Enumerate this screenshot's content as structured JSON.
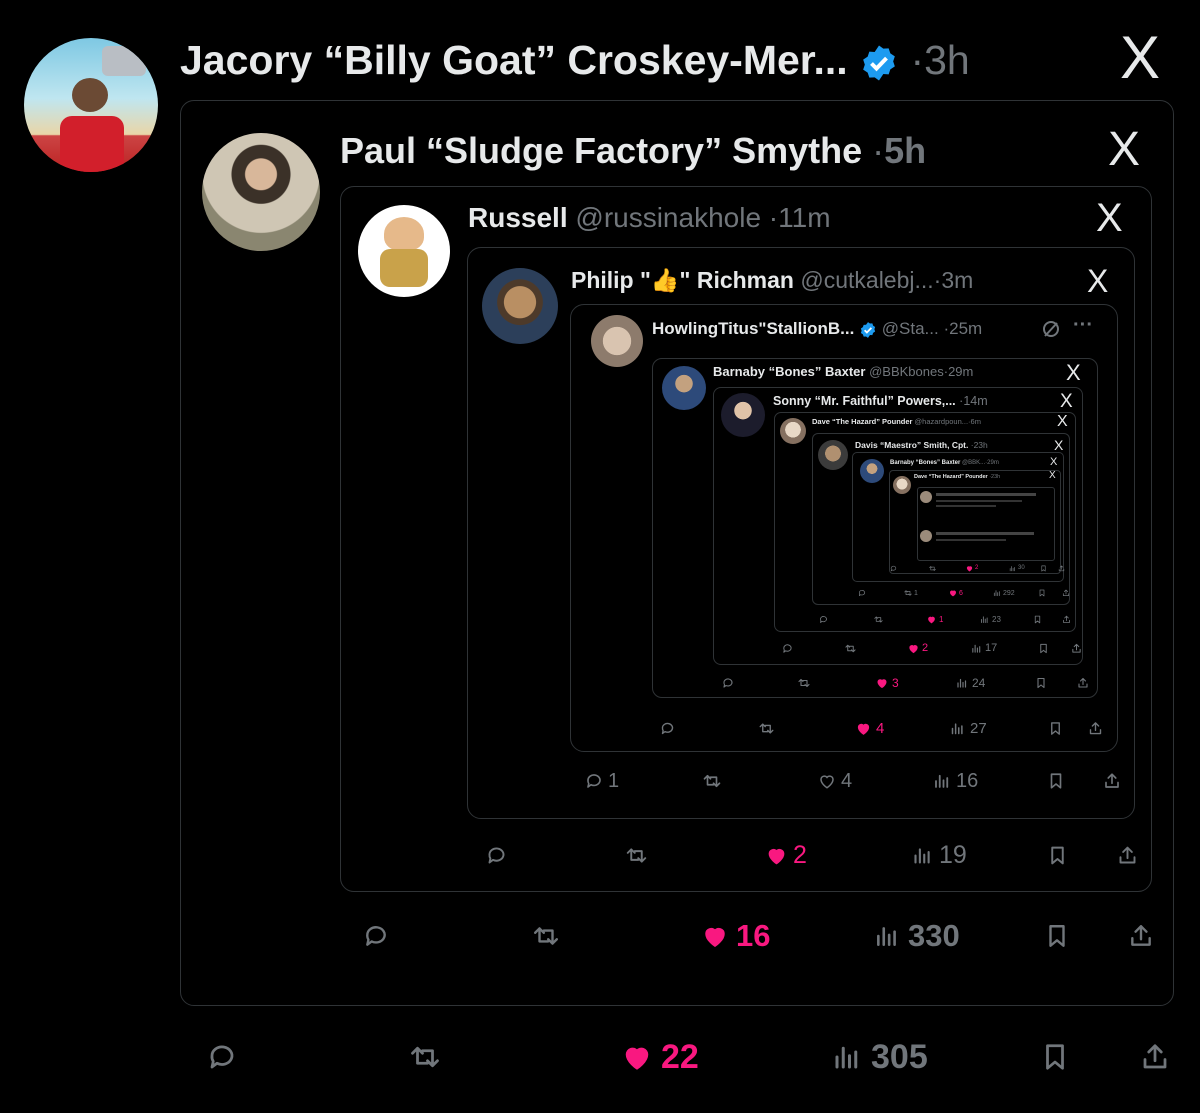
{
  "colors": {
    "background": "#000000",
    "text": "#e7e9ea",
    "muted": "#71767b",
    "like": "#f91880",
    "verified": "#1d9bf0",
    "border": "#2f3336"
  },
  "icons": {
    "reply": "reply-icon",
    "repost": "repost-icon",
    "like": "heart-icon",
    "views": "views-icon",
    "bookmark": "bookmark-icon",
    "share": "share-icon",
    "logo": "x-logo-icon"
  },
  "logo_text": "X",
  "dot": "·",
  "tweets": [
    {
      "name": "Jacory “Billy Goat” Croskey-Mer...",
      "handle": "",
      "time": "3h",
      "verified": true,
      "stats": {
        "replies": "",
        "reposts": "",
        "likes": "22",
        "views": "305"
      }
    },
    {
      "name": "Paul “Sludge Factory” Smythe",
      "handle": "",
      "time": "5h",
      "stats": {
        "replies": "",
        "reposts": "",
        "likes": "16",
        "views": "330"
      }
    },
    {
      "name": "Russell",
      "handle": "@russinakhole",
      "time": "11m",
      "stats": {
        "replies": "",
        "reposts": "",
        "likes": "2",
        "views": "19"
      }
    },
    {
      "name_pre": "Philip \"",
      "name_post": "\" Richman",
      "emoji": "👍",
      "handle": "@cutkalebj...",
      "time": "3m",
      "stats": {
        "replies": "1",
        "reposts": "",
        "likes": "4",
        "views": "16"
      }
    },
    {
      "name": "HowlingTitus\"StallionB...",
      "handle": "@Sta...",
      "time": "25m",
      "verified": true,
      "stats": {
        "replies": "",
        "reposts": "",
        "likes": "4",
        "views": "27"
      }
    },
    {
      "name": "Barnaby “Bones” Baxter",
      "handle": "@BBKbones",
      "time": "29m",
      "stats": {
        "replies": "",
        "reposts": "",
        "likes": "3",
        "views": "24"
      }
    },
    {
      "name": "Sonny “Mr. Faithful” Powers,...",
      "handle": "",
      "time": "14m",
      "stats": {
        "replies": "",
        "reposts": "",
        "likes": "2",
        "views": "17"
      }
    },
    {
      "name": "Dave “The Hazard” Pounder",
      "handle": "@hazardpoun...",
      "time": "6m",
      "stats": {
        "replies": "",
        "reposts": "",
        "likes": "1",
        "views": "23"
      }
    },
    {
      "name": "Davis “Maestro” Smith, Cpt.",
      "handle": "",
      "time": "23h",
      "stats": {
        "replies": "",
        "reposts": "1",
        "likes": "6",
        "views": "292"
      }
    },
    {
      "name": "Barnaby “Bones” Baxter",
      "handle": "@BBK...",
      "time": "29m",
      "stats": {
        "replies": "",
        "reposts": "",
        "likes": "2",
        "views": "30"
      }
    },
    {
      "name": "Dave “The Hazard” Pounder",
      "handle": "",
      "time": "23h",
      "stats": {}
    }
  ]
}
